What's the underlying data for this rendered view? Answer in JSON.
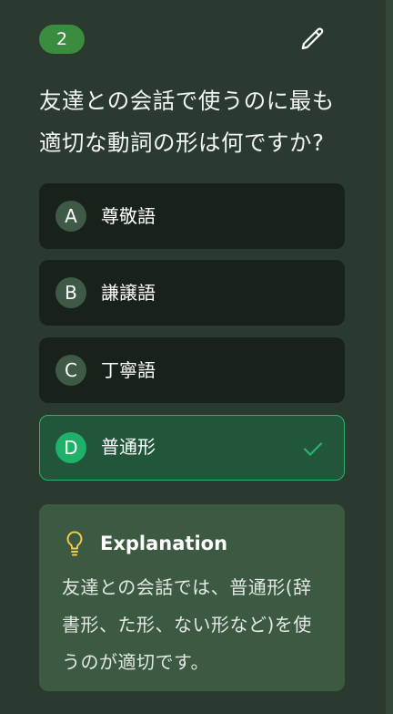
{
  "question": {
    "number": "2",
    "text": "友達との会話で使うのに最も適切な動詞の形は何ですか?"
  },
  "options": [
    {
      "letter": "A",
      "label": "尊敬語"
    },
    {
      "letter": "B",
      "label": "謙譲語"
    },
    {
      "letter": "C",
      "label": "丁寧語"
    },
    {
      "letter": "D",
      "label": "普通形"
    }
  ],
  "selected_option": "D",
  "explanation": {
    "title": "Explanation",
    "text": "友達との会話では、普通形(辞書形、た形、ない形など)を使うのが適切です。"
  },
  "icons": {
    "edit": "pencil-icon",
    "correct": "check-icon",
    "explanation": "lightbulb-icon"
  },
  "colors": {
    "accent": "#2ab36c",
    "badge": "#3a8c3e",
    "lightbulb": "#f2c94c"
  }
}
